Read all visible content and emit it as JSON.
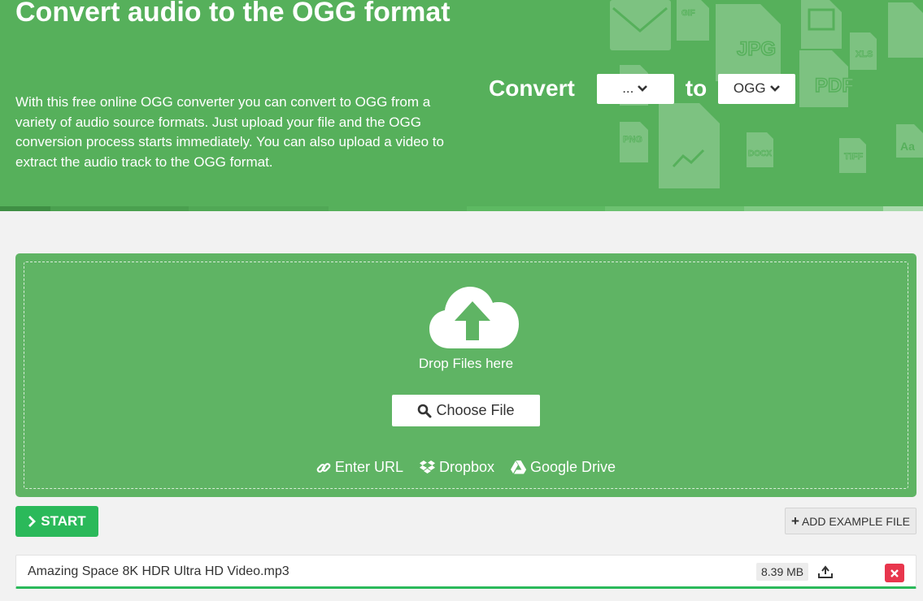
{
  "header": {
    "title": "Convert audio to the OGG format",
    "description": "With this free online OGG converter you can convert to OGG from a variety of audio source formats. Just upload your file and the OGG conversion process starts immediately. You can also upload a video to extract the audio track to the OGG format.",
    "convert_label": "Convert",
    "from_format": "...",
    "to_label": "to",
    "to_format": "OGG",
    "background_icons": [
      "GIF",
      "JPG",
      "XLS",
      "PDF",
      "PNG",
      "DOCX",
      "TIFF",
      "Aa"
    ]
  },
  "dropzone": {
    "drop_text": "Drop Files here",
    "choose_label": "Choose File",
    "sources": [
      {
        "label": "Enter URL",
        "icon": "link-icon"
      },
      {
        "label": "Dropbox",
        "icon": "dropbox-icon"
      },
      {
        "label": "Google Drive",
        "icon": "google-drive-icon"
      }
    ]
  },
  "actions": {
    "start_label": "START",
    "example_label": "ADD EXAMPLE FILE"
  },
  "file": {
    "name": "Amazing Space 8K HDR Ultra HD Video.mp3",
    "size": "8.39 MB"
  },
  "colors": {
    "header_green": "#56b05b",
    "dropzone_green": "#5fb464",
    "start_green": "#2bb95a",
    "delete_red": "#e8364d"
  }
}
